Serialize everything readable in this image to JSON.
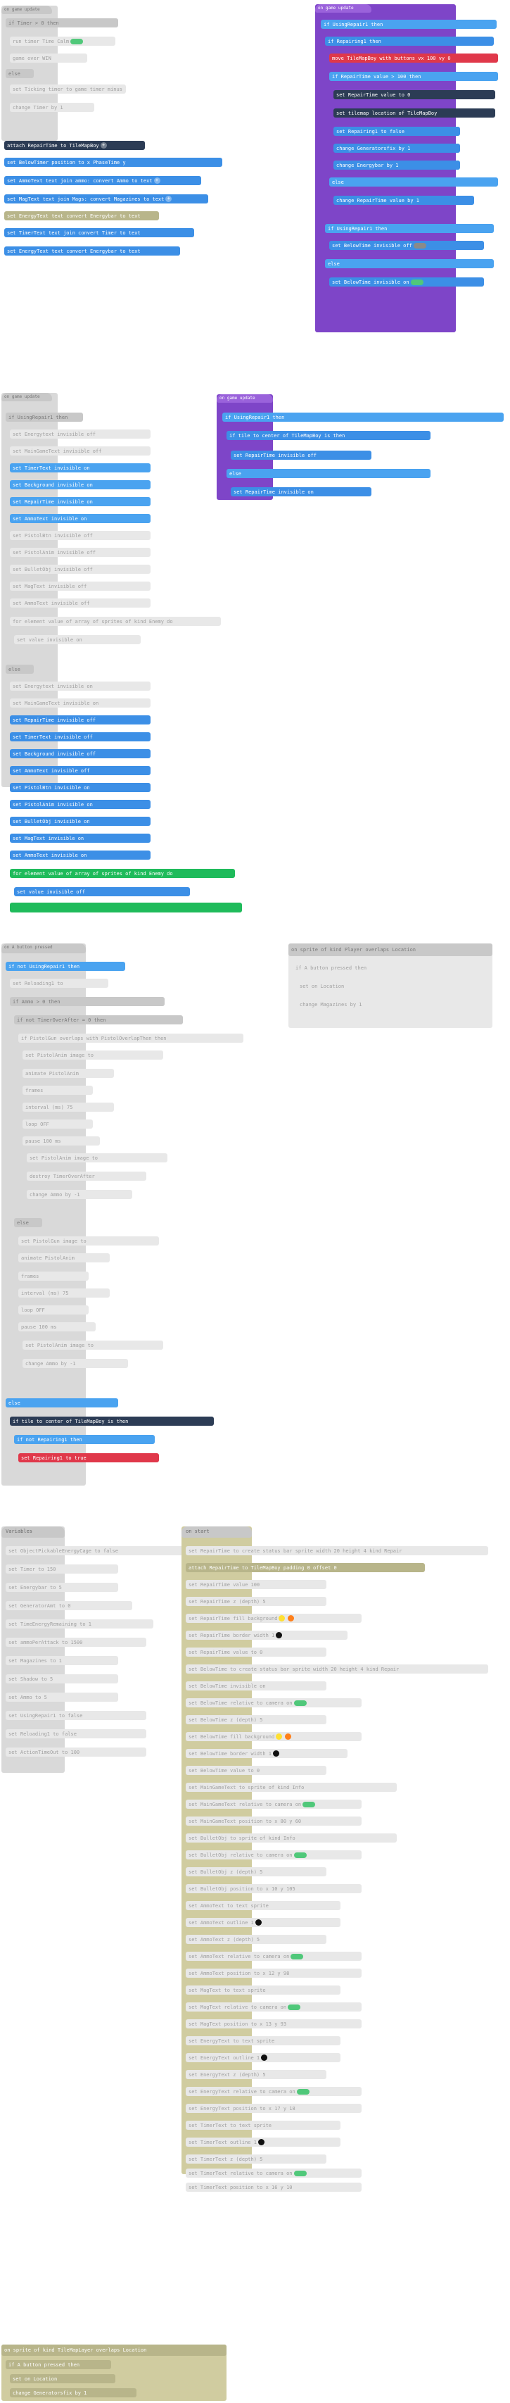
{
  "stacks": {
    "top_left_event": "on game update",
    "top_right_event": "on game update",
    "mid_event": "on game update",
    "mid_right_event": "on game update",
    "button_event": "on A button pressed",
    "overlap_event": "on sprite of kind Player overlaps",
    "variables_event": "Variables",
    "create_event": "on start",
    "bottom_event": "on sprite of kind Player overlaps"
  },
  "top_left": {
    "rows": [
      "if Timer > 0 then",
      "run timer Time Calm",
      "game over WIN",
      "else",
      "set Ticking timer to game timer minus 1000",
      "change Timer by 1",
      "attach RepairTime to TileMapBoy",
      "set BelowTimer position to x PhaseTime y",
      "set AmmoText text join ammo: convert Ammo to text",
      "set MagText text join Mags: convert Magazines to text",
      "set EnergyText text convert Energybar to text",
      "set TimerText text join convert Timer to text",
      "set EnergyText text convert Energybar to text"
    ]
  },
  "top_right": {
    "rows": [
      "if UsingRepair1 then",
      "if Repairing1 then",
      "move TileMapBoy with buttons vx 100 vy 0",
      "if RepairTime value > 100 then",
      "set RepairTime value to 0",
      "set tilemap location of TileMapBoy",
      "set Repairing1 to false",
      "change Generatorsfix by 1",
      "change Energybar by 1",
      "else",
      "change RepairTime value by 1",
      "if UsingRepair1 then",
      "set BelowTime invisible off",
      "else",
      "set BelowTime invisible on"
    ]
  },
  "mid_left": {
    "rows": [
      "if UsingRepair1 then",
      "set Energytext invisible off",
      "set MainGameText invisible off",
      "set TimerText invisible on",
      "set Background invisible on",
      "set RepairTime invisible on",
      "set AmmoText invisible on",
      "set PistolBtn invisible off",
      "set PistolAnim invisible off",
      "set BulletObj invisible off",
      "set MagText invisible off",
      "set AmmoText invisible off",
      "for element value of array of sprites of kind Enemy do",
      "set value invisible on",
      "else",
      "set Energytext invisible on",
      "set MainGameText invisible on",
      "set RepairTime invisible off",
      "set TimerText invisible off",
      "set Background invisible off",
      "set AmmoText invisible off",
      "set PistolBtn invisible on",
      "set PistolAnim invisible on",
      "set BulletObj invisible on",
      "set MagText invisible on",
      "set AmmoText invisible on",
      "for element value of array of sprites of kind Enemy do",
      "set value invisible off"
    ]
  },
  "mid_right": {
    "rows": [
      "if UsingRepair1 then",
      "if tile to center of TileMapBoy is then",
      "set RepairTime invisible off",
      "else",
      "set RepairTime invisible on"
    ]
  },
  "button": {
    "rows": [
      "if not UsingRepair1 then",
      "set Reloading1 to",
      "if Ammo > 0 then",
      "if not TimerOverAfter = 0 then",
      "if PistolGun overlaps with PistolOverlapThen then",
      "set PistolAnim image to",
      "animate PistolAnim",
      "frames",
      "interval (ms) 75",
      "loop OFF",
      "pause 100 ms",
      "set PistolAnim image to",
      "destroy TimerOverAfter",
      "change Ammo by -1",
      "else",
      "set PistolGun image to",
      "animate PistolAnim",
      "frames",
      "interval (ms) 75",
      "loop OFF",
      "pause 100 ms",
      "set PistolAnim image to",
      "change Ammo by -1",
      "else",
      "if tile to center of TileMapBoy is then",
      "if not Repairing1 then",
      "set Repairing1 to true"
    ]
  },
  "overlap": {
    "rows": [
      "on sprite of kind Player overlaps Location",
      "if A button pressed then",
      "set on Location",
      "change Magazines by 1"
    ]
  },
  "variables": {
    "title": "Variables",
    "rows": [
      "set ObjectPickableEnergyCage to false",
      "set Timer to 150",
      "set Energybar to 5",
      "set GeneratorAmt to 0",
      "set TimeEnergyRemaining to 1",
      "set ammoPerAttack to 1500",
      "set Magazines to 1",
      "set Shadow to 5",
      "set Ammo to 5",
      "set UsingRepair1 to false",
      "set Reloading1 to false",
      "set ActionTimeOut to 100"
    ]
  },
  "create": {
    "title": "on start",
    "rows": [
      "set RepairTime to create status bar sprite width 20 height 4 kind Repair",
      "attach RepairTime to TileMapBoy padding 0 offset 0",
      "set RepairTime value 100",
      "set RepairTime z (depth) 5",
      "set RepairTime fill background",
      "set RepairTime border width 1",
      "set RepairTime value to 0",
      "set BelowTime to create status bar sprite width 20 height 4 kind Repair",
      "set BelowTime invisible on",
      "set BelowTime relative to camera on",
      "set BelowTime z (depth) 5",
      "set BelowTime fill background",
      "set BelowTime border width 1",
      "set BelowTime value to 0",
      "set MainGameText to sprite of kind Info",
      "set MainGameText relative to camera on",
      "set MainGameText position to x 80 y 60",
      "set BulletObj to sprite of kind Info",
      "set BulletObj relative to camera on",
      "set BulletObj z (depth) 5",
      "set BulletObj position to x 10 y 105",
      "set AmmoText to text sprite",
      "set AmmoText outline 1",
      "set AmmoText z (depth) 5",
      "set AmmoText relative to camera on",
      "set AmmoText position to x 12 y 98",
      "set MagText to text sprite",
      "set MagText relative to camera on",
      "set MagText position to x 13 y 93",
      "set EnergyText to text sprite",
      "set EnergyText outline 1",
      "set EnergyText z (depth) 5",
      "set EnergyText relative to camera on",
      "set EnergyText position to x 17 y 18",
      "set TimerText to text sprite",
      "set TimerText outline 1",
      "set TimerText z (depth) 5",
      "set TimerText relative to camera on",
      "set TimerText position to x 16 y 10"
    ]
  },
  "bottom": {
    "rows": [
      "on sprite of kind TileMapLayer overlaps Location",
      "if A button pressed then",
      "set on Location",
      "change Generatorsfix by 1"
    ]
  }
}
